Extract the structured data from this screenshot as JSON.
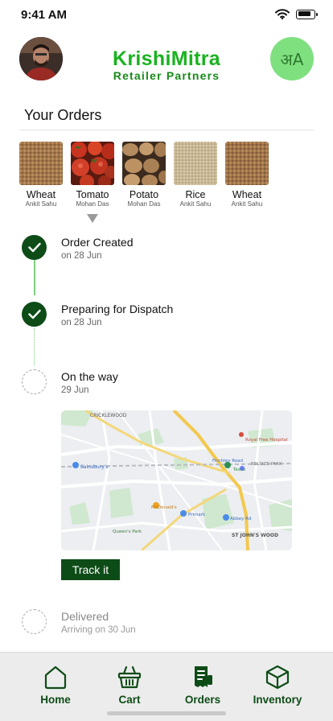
{
  "status_bar": {
    "time": "9:41 AM",
    "battery_level": 0.85
  },
  "header": {
    "brand_title": "KrishiMitra",
    "brand_subtitle": "Retailer Partners",
    "language_button_label": "अA",
    "avatar_icon": "user-avatar",
    "brand_color": "#19b31f"
  },
  "orders": {
    "section_title": "Your Orders",
    "selected_index": 1,
    "products": [
      {
        "name": "Wheat",
        "seller": "Ankit Sahu"
      },
      {
        "name": "Tomato",
        "seller": "Mohan Das"
      },
      {
        "name": "Potato",
        "seller": "Mohan Das"
      },
      {
        "name": "Rice",
        "seller": "Ankit Sahu"
      },
      {
        "name": "Wheat",
        "seller": "Ankit Sahu"
      }
    ]
  },
  "timeline": {
    "steps": [
      {
        "label": "Order Created",
        "date": "on 28 Jun",
        "status": "done"
      },
      {
        "label": "Preparing for Dispatch",
        "date": "on 28 Jun",
        "status": "done"
      },
      {
        "label": "On the way",
        "date": "29 Jun",
        "status": "pending"
      },
      {
        "label": "Delivered",
        "date": "Arriving on 30 Jun",
        "status": "upcoming"
      }
    ],
    "track_button_label": "Track it"
  },
  "map": {
    "labels": {
      "cricklewood": "CRICKLEWOOD",
      "sainsburys": "Sainsbury's",
      "belsize_park": "BELSIZE PARK",
      "royal_free": "Royal Free Hospital",
      "primark": "Primark",
      "abbey_rd": "Abbey Rd",
      "mcdonalds": "McDonald's",
      "queens_park": "Queen's Park",
      "st_johns_wood": "ST JOHN'S WOOD",
      "finchley": "Finchley Road",
      "tesco": "Tesco"
    }
  },
  "bottom_nav": {
    "items": [
      {
        "label": "Home",
        "icon": "home-icon"
      },
      {
        "label": "Cart",
        "icon": "basket-icon"
      },
      {
        "label": "Orders",
        "icon": "receipt-icon"
      },
      {
        "label": "Inventory",
        "icon": "box-icon"
      }
    ],
    "active_color": "#0e4c17"
  }
}
